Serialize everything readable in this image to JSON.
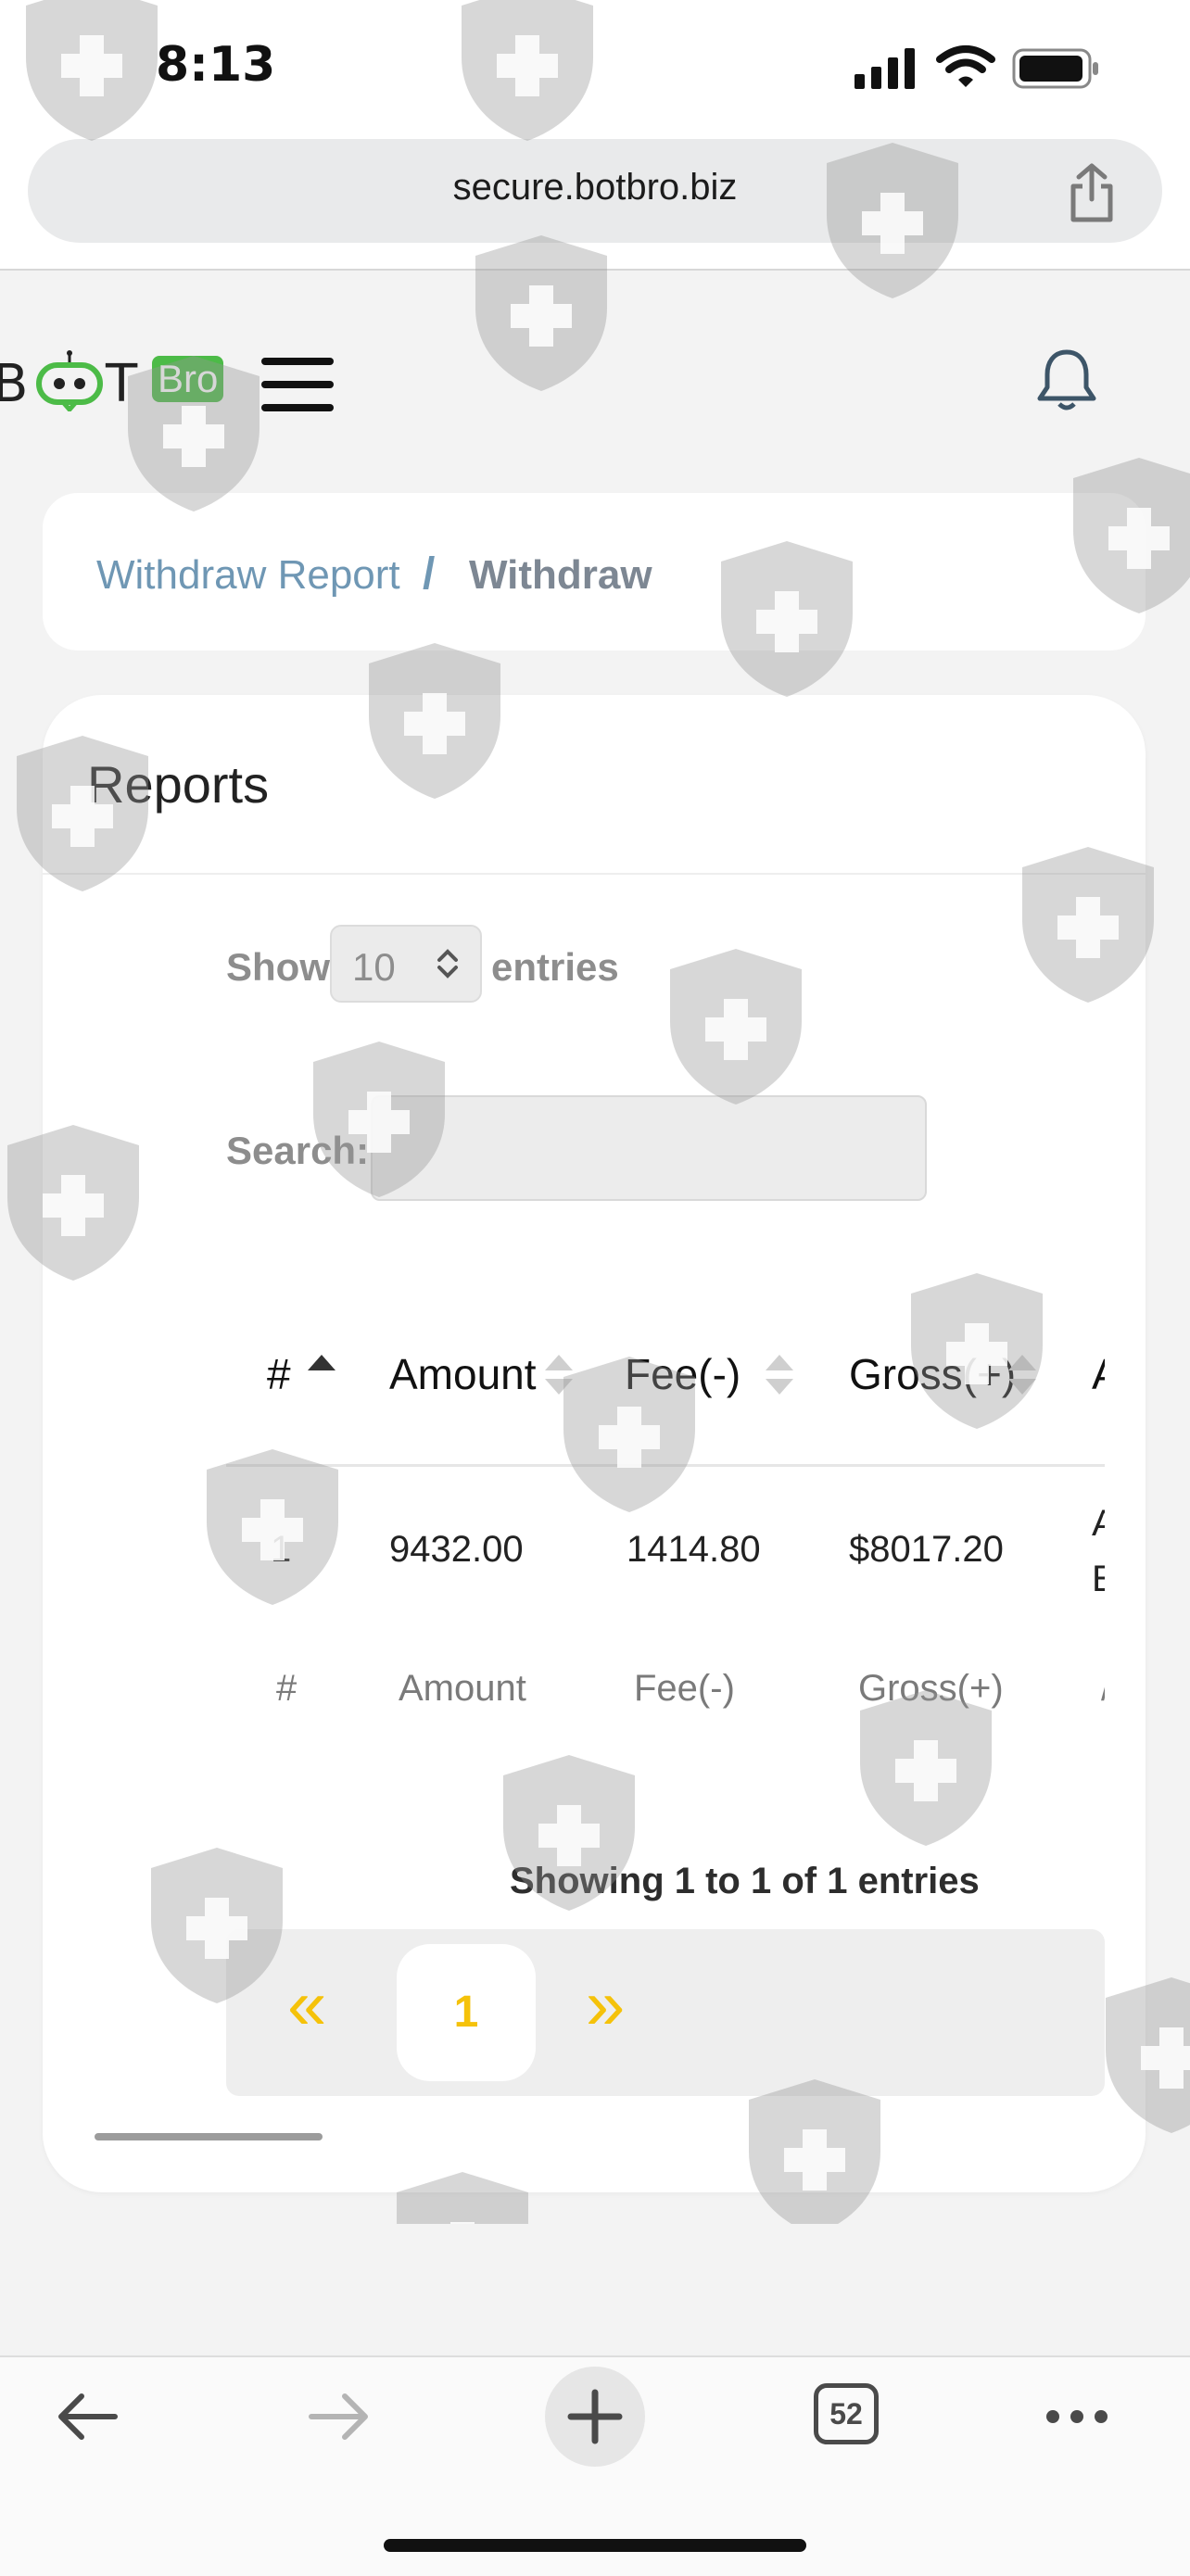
{
  "status": {
    "time": "8:13"
  },
  "browser": {
    "url": "secure.botbro.biz",
    "tab_count": "52"
  },
  "brand": {
    "logo_left": "B",
    "logo_right": "T",
    "logo_badge": "Bro"
  },
  "breadcrumb": {
    "parent": "Withdraw Report",
    "separator": "/",
    "current": "Withdraw"
  },
  "reports": {
    "title": "Reports",
    "show_label": "Show",
    "page_length": "10",
    "entries_label": "entries",
    "search_label": "Search:",
    "columns": [
      "#",
      "Amount",
      "Fee(-)",
      "Gross(+)",
      "A"
    ],
    "rows": [
      {
        "index": "1",
        "amount": "9432.00",
        "fee": "1414.80",
        "gross": "$8017.20",
        "extra_line1": "A",
        "extra_line2": "E"
      }
    ],
    "footer_columns": [
      "#",
      "Amount",
      "Fee(-)",
      "Gross(+)",
      "/"
    ],
    "info": "Showing 1 to 1 of 1 entries",
    "pagination": {
      "prev": "«",
      "current": "1",
      "next": "»"
    }
  },
  "colors": {
    "accent": "#f5c20a",
    "brand_green": "#4cbb47",
    "link": "#6f97b4"
  }
}
